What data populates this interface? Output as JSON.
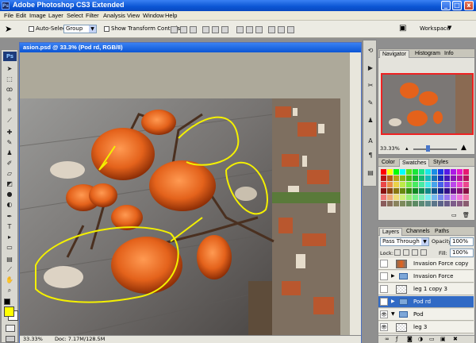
{
  "window": {
    "title": "Adobe Photoshop CS3 Extended",
    "app_icon": "Ps",
    "minimize": "_",
    "maximize": "□",
    "close": "x"
  },
  "menu": [
    "File",
    "Edit",
    "Image",
    "Layer",
    "Select",
    "Filter",
    "Analysis",
    "View",
    "Window",
    "Help"
  ],
  "options_bar": {
    "auto_select_label": "Auto-Select:",
    "auto_select_value": "Group",
    "show_transform_label": "Show Transform Controls",
    "workspace_label": "Workspace"
  },
  "tools": {
    "logo": "Ps"
  },
  "document": {
    "title": "asion.psd @ 33.3% (Pod rd, RGB/8)",
    "zoom": "33.33%",
    "doc_size": "Doc: 7.17M/128.5M"
  },
  "navigator": {
    "tabs": [
      "Navigator",
      "Histogram",
      "Info"
    ],
    "zoom": "33.33%"
  },
  "swatches": {
    "tabs": [
      "Color",
      "Swatches",
      "Styles"
    ]
  },
  "layers": {
    "tabs": [
      "Layers",
      "Channels",
      "Paths"
    ],
    "blend_mode": "Pass Through",
    "opacity_label": "Opacity:",
    "opacity_value": "100%",
    "lock_label": "Lock:",
    "fill_label": "Fill:",
    "fill_value": "100%",
    "rows": [
      {
        "name": "Invasion Force copy",
        "type": "layer",
        "visible": false,
        "selected": false
      },
      {
        "name": "Invasion Force",
        "type": "folder",
        "visible": false,
        "selected": false
      },
      {
        "name": "leg 1 copy 3",
        "type": "layer",
        "visible": false,
        "selected": false
      },
      {
        "name": "Pod rd",
        "type": "folder",
        "visible": true,
        "selected": true
      },
      {
        "name": "Pod",
        "type": "folder",
        "visible": true,
        "selected": false
      },
      {
        "name": "leg 3",
        "type": "layer",
        "visible": true,
        "selected": false
      }
    ]
  },
  "colors": {
    "foreground": "#ffff00",
    "background": "#ffffff",
    "selection": "#316ac5",
    "titlebar": "#0b55d4"
  }
}
